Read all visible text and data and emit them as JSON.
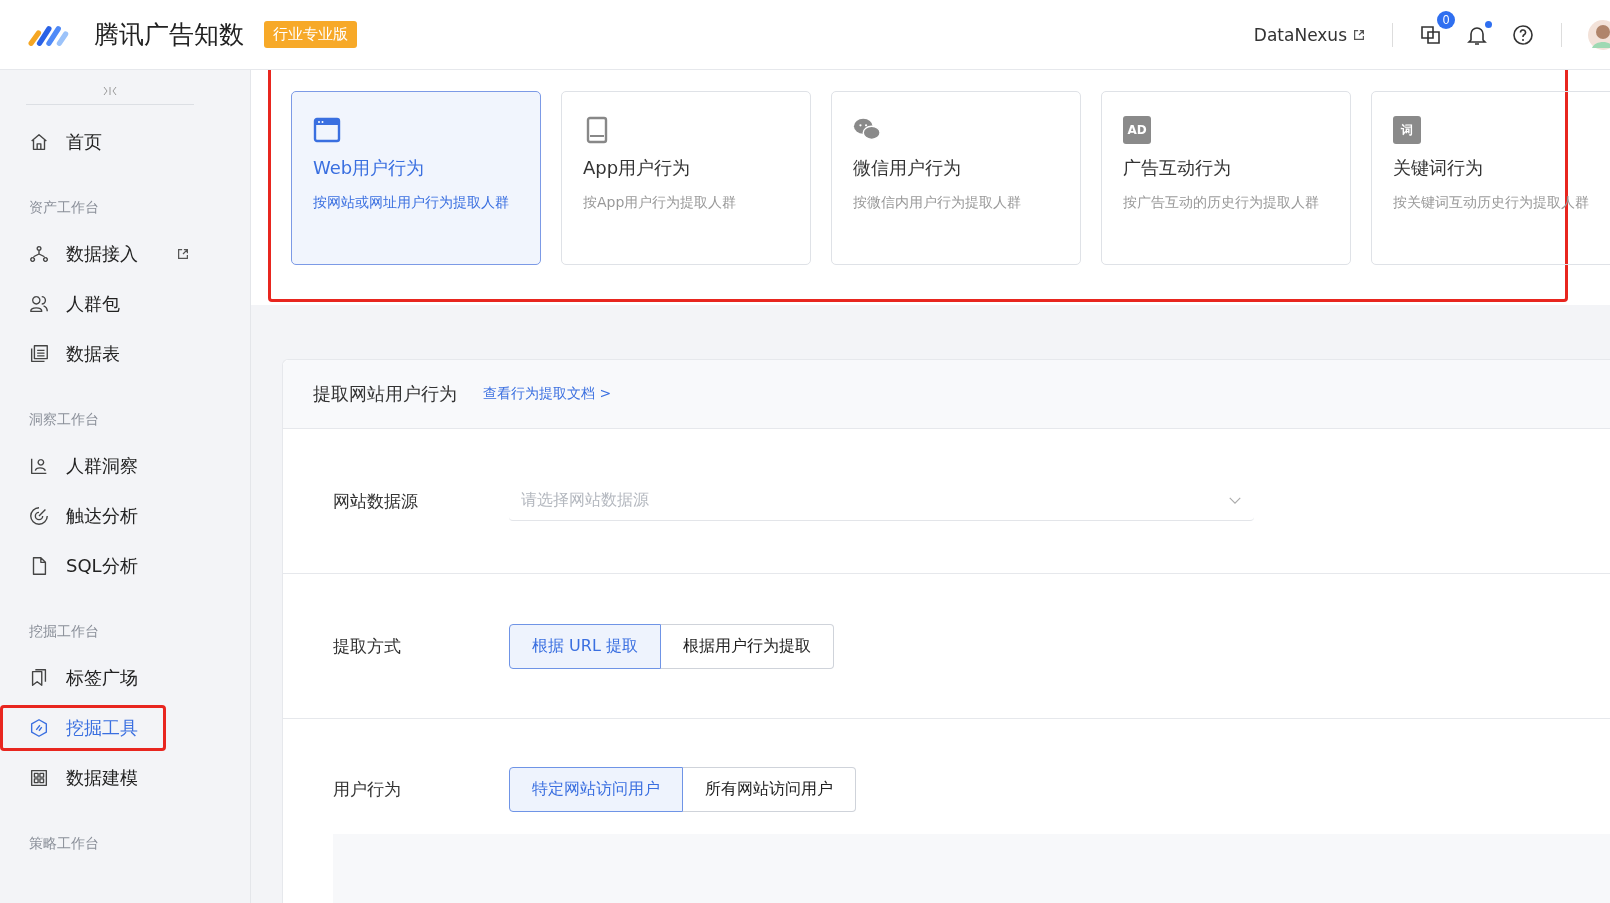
{
  "header": {
    "product_name": "腾讯广告知数",
    "edition_badge": "行业专业版",
    "link": "DataNexus",
    "task_count": "0",
    "notification_unread": true
  },
  "sidebar": {
    "items": [
      {
        "kind": "item",
        "label": "首页",
        "selected": false
      },
      {
        "kind": "group",
        "label": "资产工作台"
      },
      {
        "kind": "item",
        "label": "数据接入",
        "selected": false,
        "external": true
      },
      {
        "kind": "item",
        "label": "人群包",
        "selected": false
      },
      {
        "kind": "item",
        "label": "数据表",
        "selected": false
      },
      {
        "kind": "group",
        "label": "洞察工作台"
      },
      {
        "kind": "item",
        "label": "人群洞察",
        "selected": false
      },
      {
        "kind": "item",
        "label": "触达分析",
        "selected": false
      },
      {
        "kind": "item",
        "label": "SQL分析",
        "selected": false
      },
      {
        "kind": "group",
        "label": "挖掘工作台"
      },
      {
        "kind": "item",
        "label": "标签广场",
        "selected": false
      },
      {
        "kind": "item",
        "label": "挖掘工具",
        "selected": true
      },
      {
        "kind": "item",
        "label": "数据建模",
        "selected": false
      },
      {
        "kind": "group",
        "label": "策略工作台"
      }
    ]
  },
  "source_cards": [
    {
      "title": "Web用户行为",
      "description": "按网站或网址用户行为提取人群",
      "selected": true
    },
    {
      "title": "App用户行为",
      "description": "按App用户行为提取人群",
      "selected": false
    },
    {
      "title": "微信用户行为",
      "description": "按微信内用户行为提取人群",
      "selected": false
    },
    {
      "title": "广告互动行为",
      "description": "按广告互动的历史行为提取人群",
      "selected": false,
      "icon_text": "AD"
    },
    {
      "title": "关键词行为",
      "description": "按关键词互动历史行为提取人群",
      "selected": false,
      "icon_text": "词"
    }
  ],
  "form": {
    "title": "提取网站用户行为",
    "doc_link": "查看行为提取文档 >",
    "rows": [
      {
        "kind": "select",
        "label": "网站数据源",
        "placeholder": "请选择网站数据源"
      },
      {
        "kind": "segmented",
        "label": "提取方式",
        "options": [
          {
            "label": "根据 URL 提取",
            "selected": true
          },
          {
            "label": "根据用户行为提取",
            "selected": false
          }
        ]
      },
      {
        "kind": "segmented",
        "label": "用户行为",
        "options": [
          {
            "label": "特定网站访问用户",
            "selected": true
          },
          {
            "label": "所有网站访问用户",
            "selected": false
          }
        ]
      }
    ]
  }
}
